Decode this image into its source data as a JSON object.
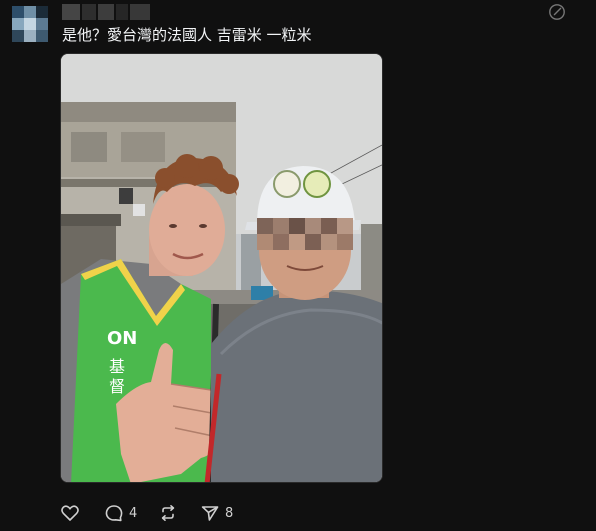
{
  "post": {
    "text": "是他？愛台灣的法國人 吉雷米 一粒米",
    "photo_alt": "Selfie of a man in a green vest giving a thumbs up next to a man in a white cap"
  },
  "actions": {
    "like_count": "",
    "reply_count": "4",
    "repost_count": "",
    "share_count": "8"
  },
  "colors": {
    "background": "#101010",
    "text": "#f3f5f7",
    "icon": "#d0d0d0",
    "vest_green": "#4bb94d"
  },
  "icons": [
    "heart-icon",
    "comment-icon",
    "repost-icon",
    "send-icon",
    "edit-icon"
  ]
}
